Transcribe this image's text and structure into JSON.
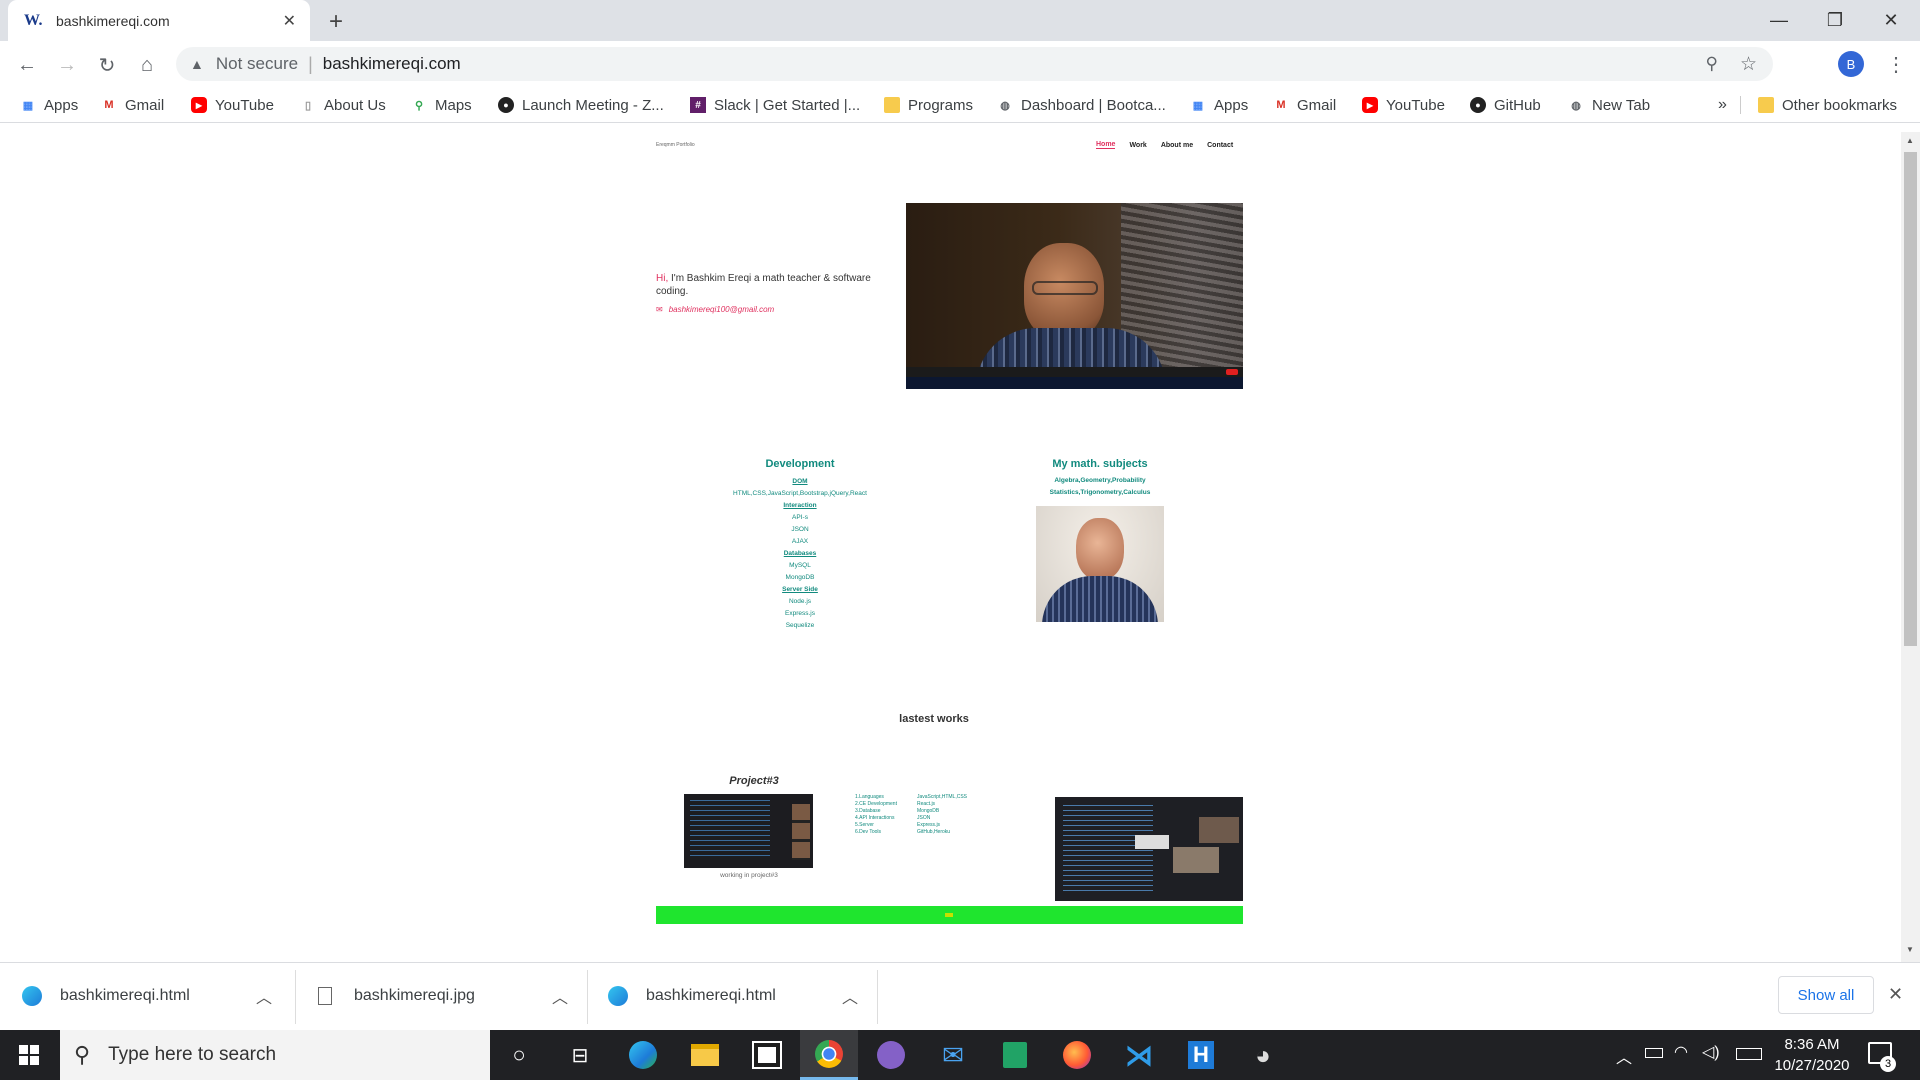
{
  "browser": {
    "tab_title": "bashkimereqi.com",
    "tab_favicon": "W.",
    "security_label": "Not secure",
    "url": "bashkimereqi.com",
    "profile_initial": "B"
  },
  "bookmarks": {
    "items": [
      "Apps",
      "Gmail",
      "YouTube",
      "About Us",
      "Maps",
      "Launch Meeting - Z...",
      "Slack | Get Started |...",
      "Programs",
      "Dashboard | Bootca...",
      "Apps",
      "Gmail",
      "YouTube",
      "GitHub",
      "New Tab"
    ],
    "more": "»",
    "other": "Other bookmarks"
  },
  "site": {
    "brand": "Ereqmm Portfolio",
    "nav": [
      "Home",
      "Work",
      "About me",
      "Contact"
    ],
    "hero": {
      "hi": "Hi,",
      "intro": " I'm Bashkim Ereqi  a math teacher & software coding.",
      "email": "bashkimereqi100@gmail.com"
    },
    "development": {
      "title": "Development",
      "lines": [
        {
          "text": "DOM",
          "heading": true
        },
        {
          "text": "HTML,CSS,JavaScript,Bootstrap,jQuery,React",
          "heading": false
        },
        {
          "text": "Interaction",
          "heading": true
        },
        {
          "text": "API-s",
          "heading": false
        },
        {
          "text": "JSON",
          "heading": false
        },
        {
          "text": "AJAX",
          "heading": false
        },
        {
          "text": "Databases",
          "heading": true
        },
        {
          "text": "MySQL",
          "heading": false
        },
        {
          "text": "MongoDB",
          "heading": false
        },
        {
          "text": "Server Side",
          "heading": true
        },
        {
          "text": "Node.js",
          "heading": false
        },
        {
          "text": "Express.js",
          "heading": false
        },
        {
          "text": "Sequelize",
          "heading": false
        }
      ]
    },
    "math": {
      "title": "My math. subjects",
      "line1": "Algebra,Geometry,Probability",
      "line2": "Statistics,Trigonometry,Calculus"
    },
    "works_title": "lastest works",
    "project": {
      "title": "Project#3",
      "caption": "working in project#3",
      "table": [
        [
          "1.Languages",
          "JavaScript,HTML,CSS"
        ],
        [
          "2.CE Development",
          "React.js"
        ],
        [
          "3.Database",
          "MongoDB"
        ],
        [
          "4.API Interactions",
          "JSON"
        ],
        [
          "5.Server",
          "Express.js"
        ],
        [
          "6.Dev Tools",
          "GitHub,Heroku"
        ]
      ]
    },
    "footer_color": "#1fe52e"
  },
  "downloads": {
    "items": [
      "bashkimereqi.html",
      "bashkimereqi.jpg",
      "bashkimereqi.html"
    ],
    "show_all": "Show all"
  },
  "taskbar": {
    "search_placeholder": "Type here to search",
    "time": "8:36 AM",
    "date": "10/27/2020",
    "notifications": "3"
  },
  "colors": {
    "accent": "#118a7e",
    "pink": "#e0315f",
    "chrome_tab": "#dee1e6"
  }
}
